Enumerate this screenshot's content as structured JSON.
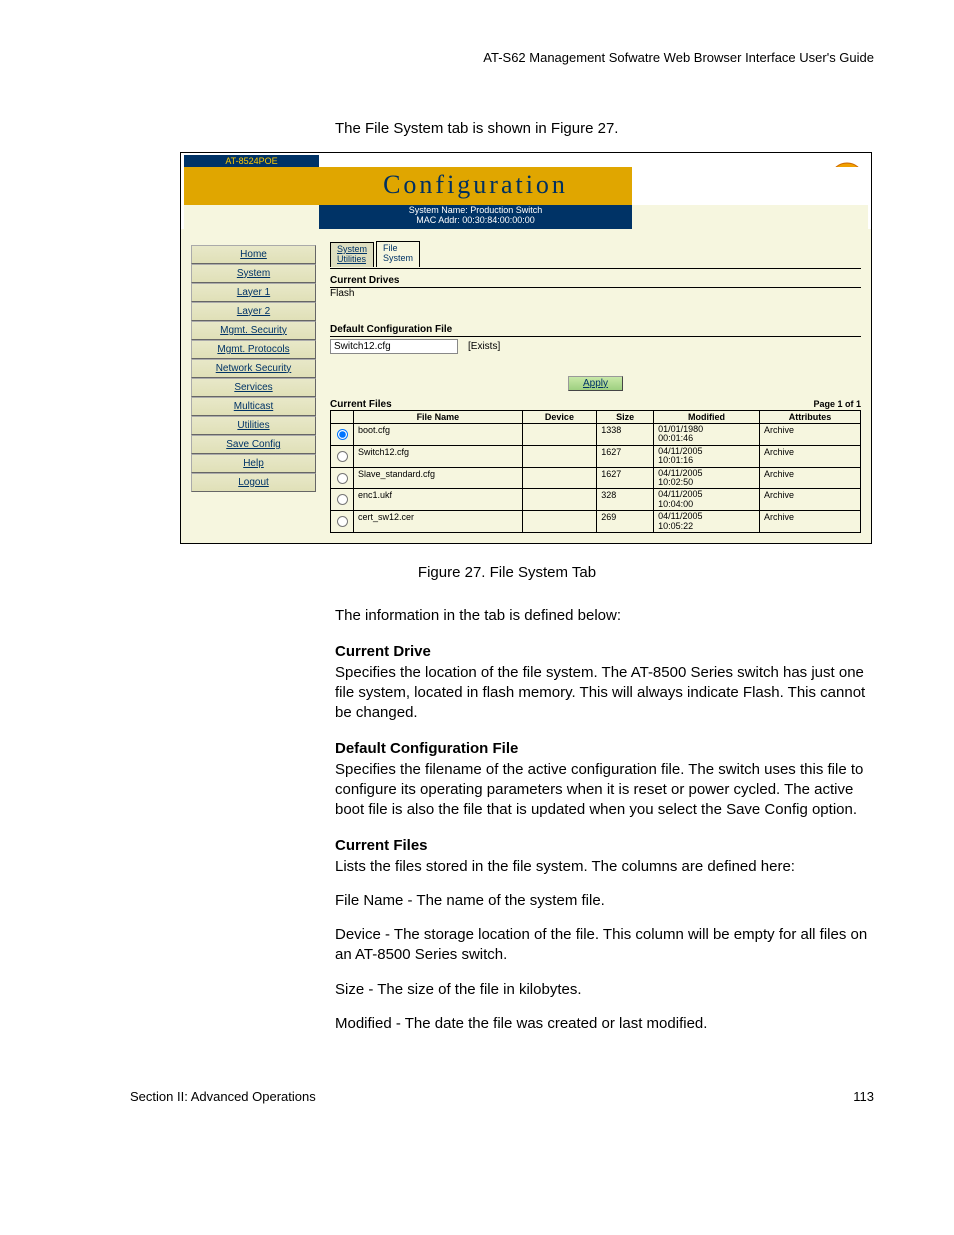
{
  "doc_header": "AT-S62 Management Sofwatre Web Browser Interface User's Guide",
  "intro": "The File System tab is shown in Figure 27.",
  "screenshot": {
    "model": "AT-8524POE",
    "title": "Configuration",
    "sys_name_line": "System Name: Production Switch",
    "mac_line": "MAC Addr: 00:30:84:00:00:00",
    "sidebar": [
      "Home",
      "System",
      "Layer 1",
      "Layer 2",
      "Mgmt. Security",
      "Mgmt. Protocols",
      "Network Security",
      "Services",
      "Multicast",
      "Utilities",
      "Save Config",
      "Help",
      "Logout"
    ],
    "tabs": {
      "left": "System\nUtilities",
      "active": "File\nSystem"
    },
    "drives_title": "Current Drives",
    "drives_value": "Flash",
    "cfg_title": "Default Configuration File",
    "cfg_value": "Switch12.cfg",
    "cfg_exists": "[Exists]",
    "apply": "Apply",
    "files_title": "Current Files",
    "page_indicator": "Page 1 of 1",
    "cols": {
      "fn": "File Name",
      "dev": "Device",
      "size": "Size",
      "mod": "Modified",
      "attr": "Attributes"
    },
    "rows": [
      {
        "sel": true,
        "fn": "boot.cfg",
        "dev": "",
        "size": "1338",
        "mod": "01/01/1980\n00:01:46",
        "attr": "Archive"
      },
      {
        "sel": false,
        "fn": "Switch12.cfg",
        "dev": "",
        "size": "1627",
        "mod": "04/11/2005\n10:01:16",
        "attr": "Archive"
      },
      {
        "sel": false,
        "fn": "Slave_standard.cfg",
        "dev": "",
        "size": "1627",
        "mod": "04/11/2005\n10:02:50",
        "attr": "Archive"
      },
      {
        "sel": false,
        "fn": "enc1.ukf",
        "dev": "",
        "size": "328",
        "mod": "04/11/2005\n10:04:00",
        "attr": "Archive"
      },
      {
        "sel": false,
        "fn": "cert_sw12.cer",
        "dev": "",
        "size": "269",
        "mod": "04/11/2005\n10:05:22",
        "attr": "Archive"
      }
    ]
  },
  "caption": "Figure 27. File System Tab",
  "para1": "The information in the tab is defined below:",
  "h1": "Current Drive",
  "h1p": "Specifies the location of the file system. The AT-8500 Series switch has just one file system, located in flash memory. This will always indicate Flash. This cannot be changed.",
  "h2": "Default Configuration File",
  "h2p": "Specifies the filename of the active configuration file. The switch uses this file to configure its operating parameters when it is reset or power cycled. The active boot file is also the file that is updated when you select the Save Config option.",
  "h3": "Current Files",
  "h3p": "Lists the files stored in the file system. The columns are defined here:",
  "d1": "File Name - The name of the system file.",
  "d2": "Device - The storage location of the file. This column will be empty for all files on an AT-8500 Series switch.",
  "d3": "Size - The size of the file in kilobytes.",
  "d4": "Modified - The date the file was created or last modified.",
  "footer_left": "Section II: Advanced Operations",
  "footer_right": "113"
}
